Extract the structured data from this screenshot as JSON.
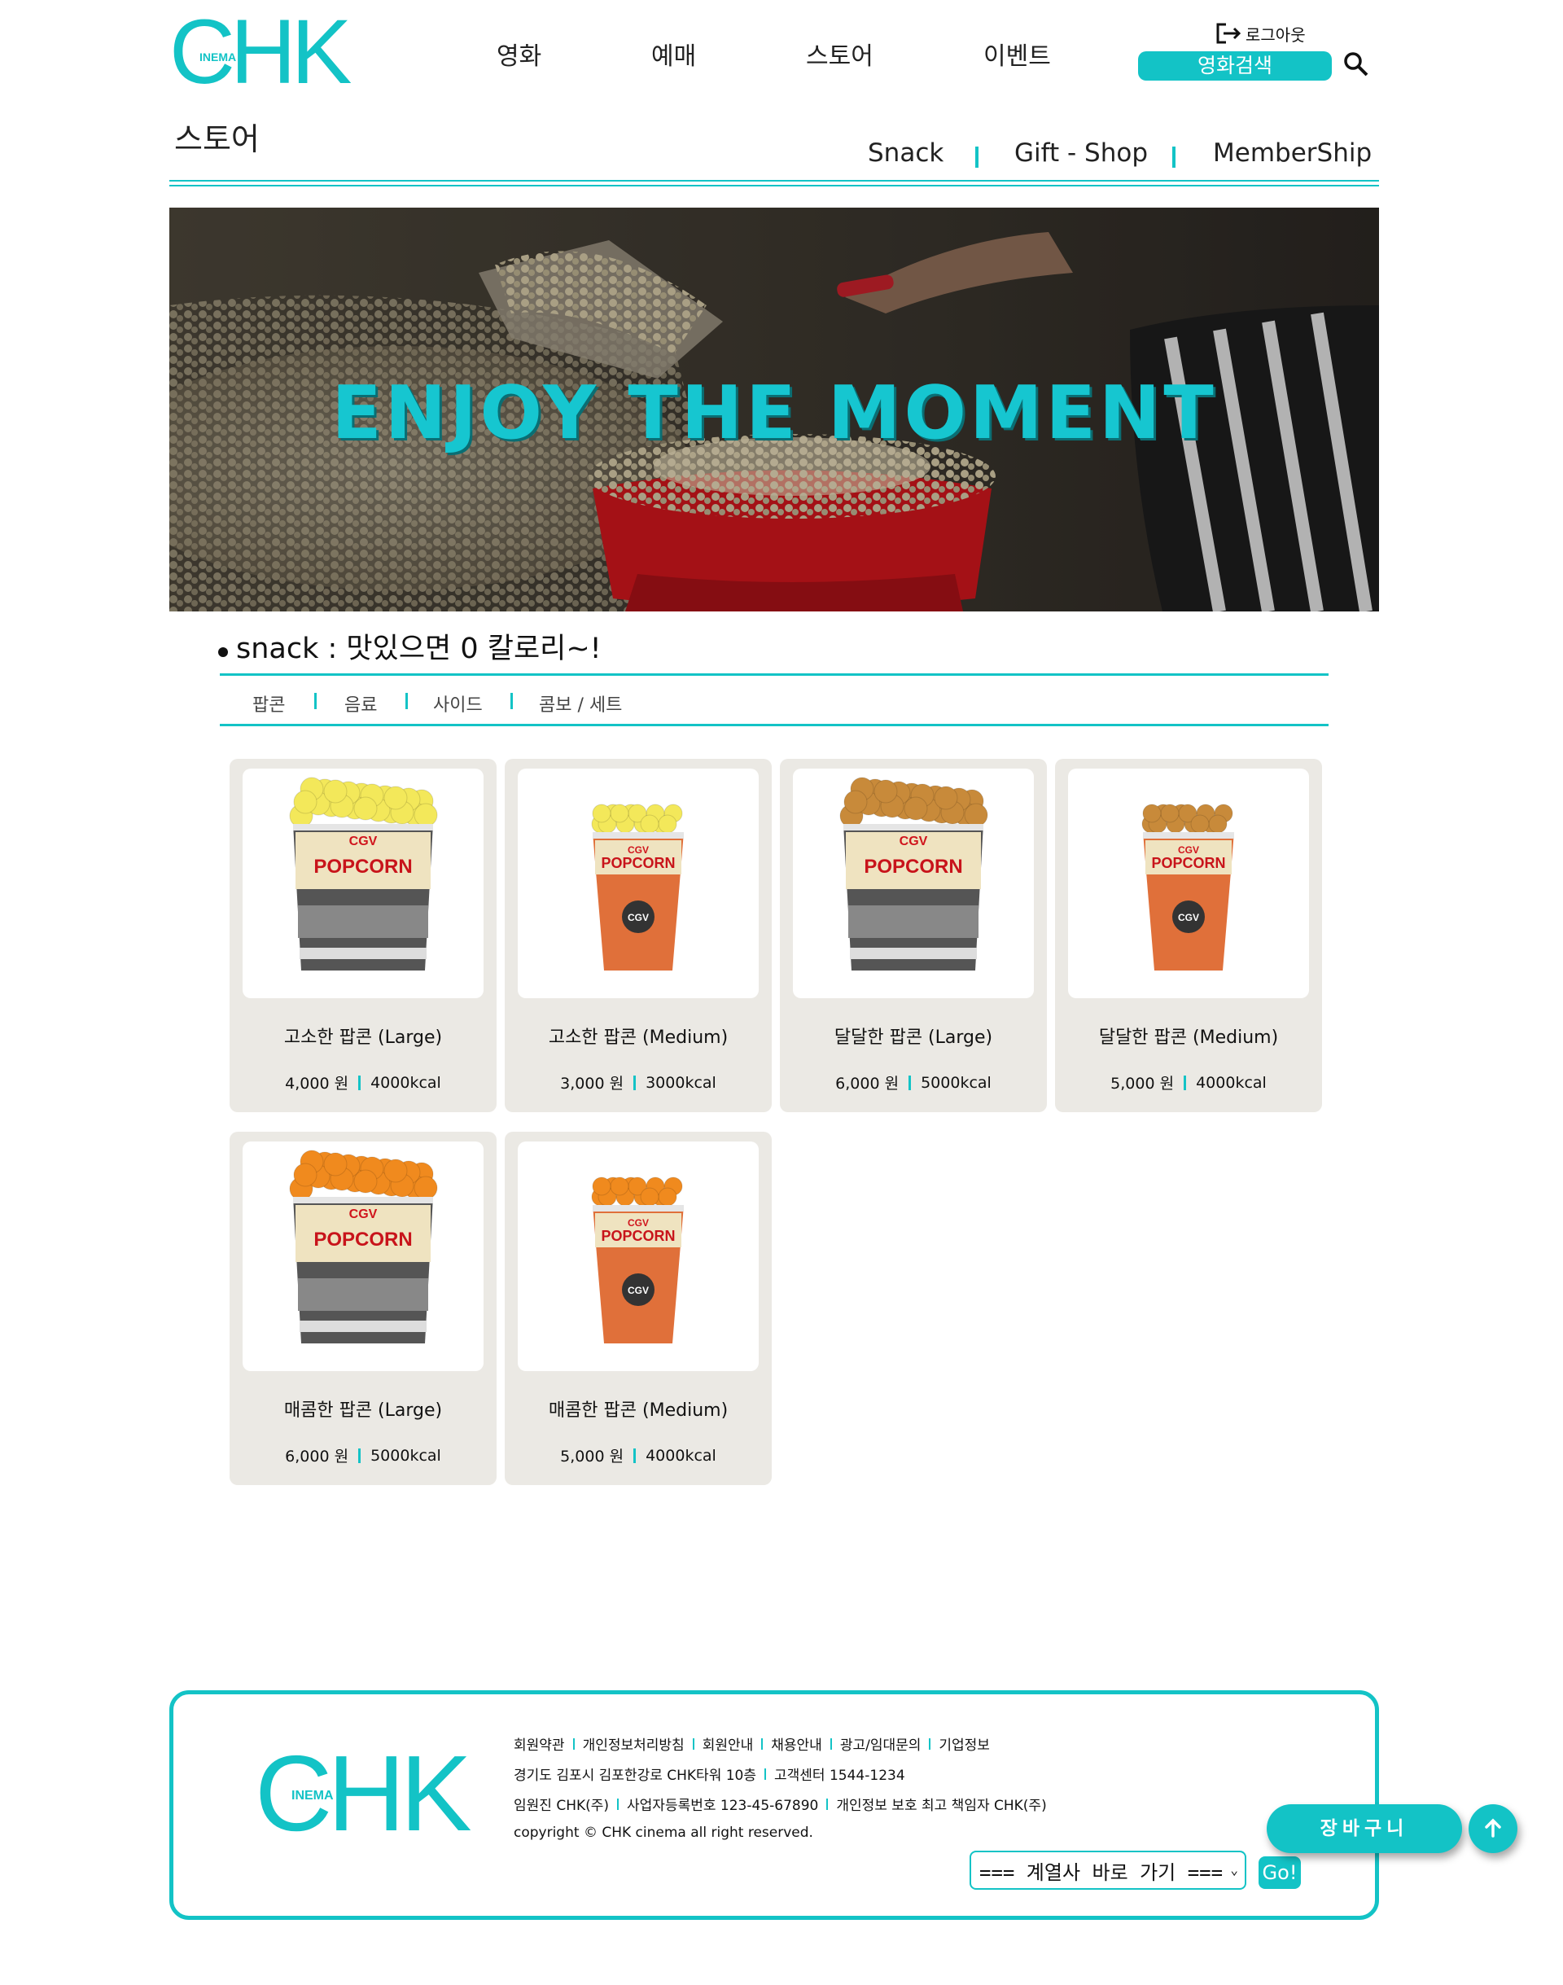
{
  "brand": {
    "logo_big": "CHK",
    "logo_small": "INEMA",
    "accent": "#13c3c6"
  },
  "nav": [
    "영화",
    "예매",
    "스토어",
    "이벤트"
  ],
  "auth": {
    "logout_label": "로그아웃",
    "search_label": "영화검색"
  },
  "page": {
    "title": "스토어",
    "subnav": [
      "Snack",
      "Gift - Shop",
      "MemberShip"
    ]
  },
  "banner": {
    "text": "ENJOY THE MOMENT"
  },
  "section": {
    "title": "snack : 맛있으면 0 칼로리~!",
    "categories": [
      "팝콘",
      "음료",
      "사이드",
      "콤보 / 세트"
    ]
  },
  "products": [
    {
      "name": "고소한 팝콘 (Large)",
      "price": "4,000 원",
      "kcal": "4000kcal",
      "size": "large",
      "color": "#f3e85a"
    },
    {
      "name": "고소한 팝콘 (Medium)",
      "price": "3,000 원",
      "kcal": "3000kcal",
      "size": "medium",
      "color": "#f3e85a"
    },
    {
      "name": "달달한 팝콘 (Large)",
      "price": "6,000 원",
      "kcal": "5000kcal",
      "size": "large",
      "color": "#c88a3a"
    },
    {
      "name": "달달한 팝콘 (Medium)",
      "price": "5,000 원",
      "kcal": "4000kcal",
      "size": "medium",
      "color": "#c88a3a"
    },
    {
      "name": "매콤한 팝콘 (Large)",
      "price": "6,000 원",
      "kcal": "5000kcal",
      "size": "large",
      "color": "#f08a1e"
    },
    {
      "name": "매콤한 팝콘 (Medium)",
      "price": "5,000 원",
      "kcal": "4000kcal",
      "size": "medium",
      "color": "#f08a1e"
    }
  ],
  "cup_text": {
    "brand": "CGV",
    "word": "POPCORN"
  },
  "footer": {
    "links": [
      "회원약관",
      "개인정보처리방침",
      "회원안내",
      "채용안내",
      "광고/임대문의",
      "기업정보"
    ],
    "address": "경기도 김포시 김포한강로 CHK타워 10층",
    "call_center": "고객센터 1544-1234",
    "executive": "임원진 CHK(주)",
    "business_no": "사업자등록번호 123-45-67890",
    "privacy_officer": "개인정보 보호 최고 책임자 CHK(주)",
    "copyright": "copyright © CHK cinema all right reserved.",
    "family_select": "=== 계열사 바로 가기 ===",
    "go_label": "Go!"
  },
  "floating": {
    "cart_label": "장바구니"
  }
}
